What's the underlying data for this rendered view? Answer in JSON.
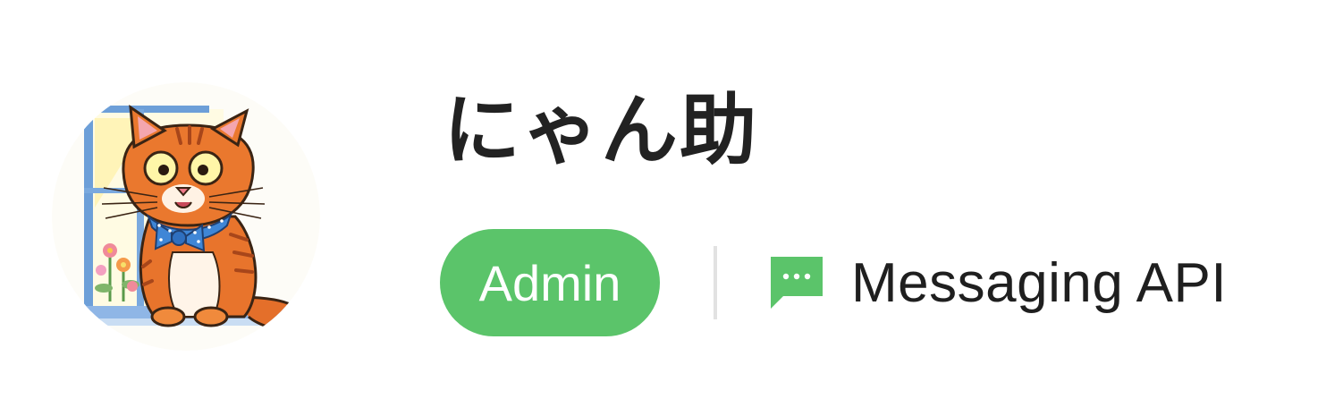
{
  "profile": {
    "name": "にゃん助",
    "avatar_icon": "cat-avatar-icon",
    "role_badge": "Admin",
    "channel_type": "Messaging API",
    "channel_icon": "chat-bubble-icon"
  },
  "colors": {
    "badge_bg": "#5bc46a",
    "badge_text": "#ffffff",
    "channel_icon": "#5bc46a",
    "divider": "#e2e2e2",
    "text": "#1f1f1f"
  }
}
